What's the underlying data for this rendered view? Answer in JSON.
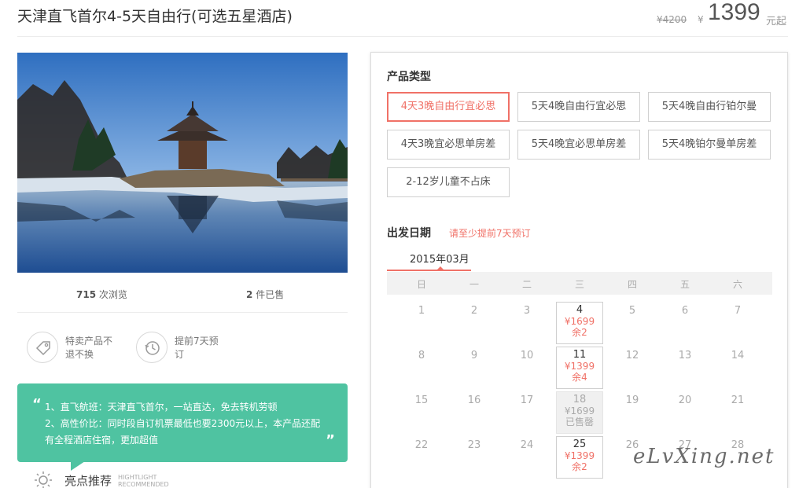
{
  "product": {
    "title": "天津直飞首尔4-5天自由行(可选五星酒店)",
    "original_price": "¥4200",
    "currency_symbol": "¥",
    "price": "1399",
    "price_suffix": "元起"
  },
  "stats": {
    "views_count": "715",
    "views_label": "次浏览",
    "sold_count": "2",
    "sold_label": "件已售"
  },
  "features": [
    {
      "icon": "tag-icon",
      "line1": "特卖产品不",
      "line2": "退不换"
    },
    {
      "icon": "clock-history-icon",
      "line1": "提前7天预",
      "line2": "订"
    }
  ],
  "notice": {
    "quote_open": "“",
    "line1": "1、直飞航班：天津直飞首尔，一站直达，免去转机劳顿",
    "line2": "2、高性价比：同时段自订机票最低也要2300元以上，本产品还配",
    "line3": "有全程酒店住宿，更加超值",
    "quote_close": "”"
  },
  "highlights": {
    "title": "亮点推荐",
    "sub1": "HIGHTLIGHT",
    "sub2": "RECOMMENDED"
  },
  "booking": {
    "type_label": "产品类型",
    "options": [
      "4天3晚自由行宜必思",
      "5天4晚自由行宜必思",
      "5天4晚自由行铂尔曼",
      "4天3晚宜必思单房差",
      "5天4晚宜必思单房差",
      "5天4晚铂尔曼单房差",
      "2-12岁儿童不占床"
    ],
    "selected_option": "4天3晚自由行宜必思",
    "date_label": "出发日期",
    "date_hint": "请至少提前7天预订",
    "month": "2015年03月",
    "weekdays": [
      "日",
      "一",
      "二",
      "三",
      "四",
      "五",
      "六"
    ],
    "weeks": [
      [
        "1",
        "2",
        "3",
        "4",
        "5",
        "6",
        "7"
      ],
      [
        "8",
        "9",
        "10",
        "11",
        "12",
        "13",
        "14"
      ],
      [
        "15",
        "16",
        "17",
        "18",
        "19",
        "20",
        "21"
      ],
      [
        "22",
        "23",
        "24",
        "25",
        "26",
        "27",
        "28"
      ]
    ],
    "availability": {
      "4": {
        "price": "¥1699",
        "remain": "余2"
      },
      "11": {
        "price": "¥1399",
        "remain": "余4"
      },
      "18": {
        "price": "¥1699",
        "remain": "已售罄",
        "sold_out": true
      },
      "25": {
        "price": "¥1399",
        "remain": "余2"
      }
    }
  },
  "colors": {
    "accent": "#f07167",
    "notice_bg": "#4fc3a1",
    "sky": "#3f7fc4"
  },
  "watermark": "eLvXing.net"
}
